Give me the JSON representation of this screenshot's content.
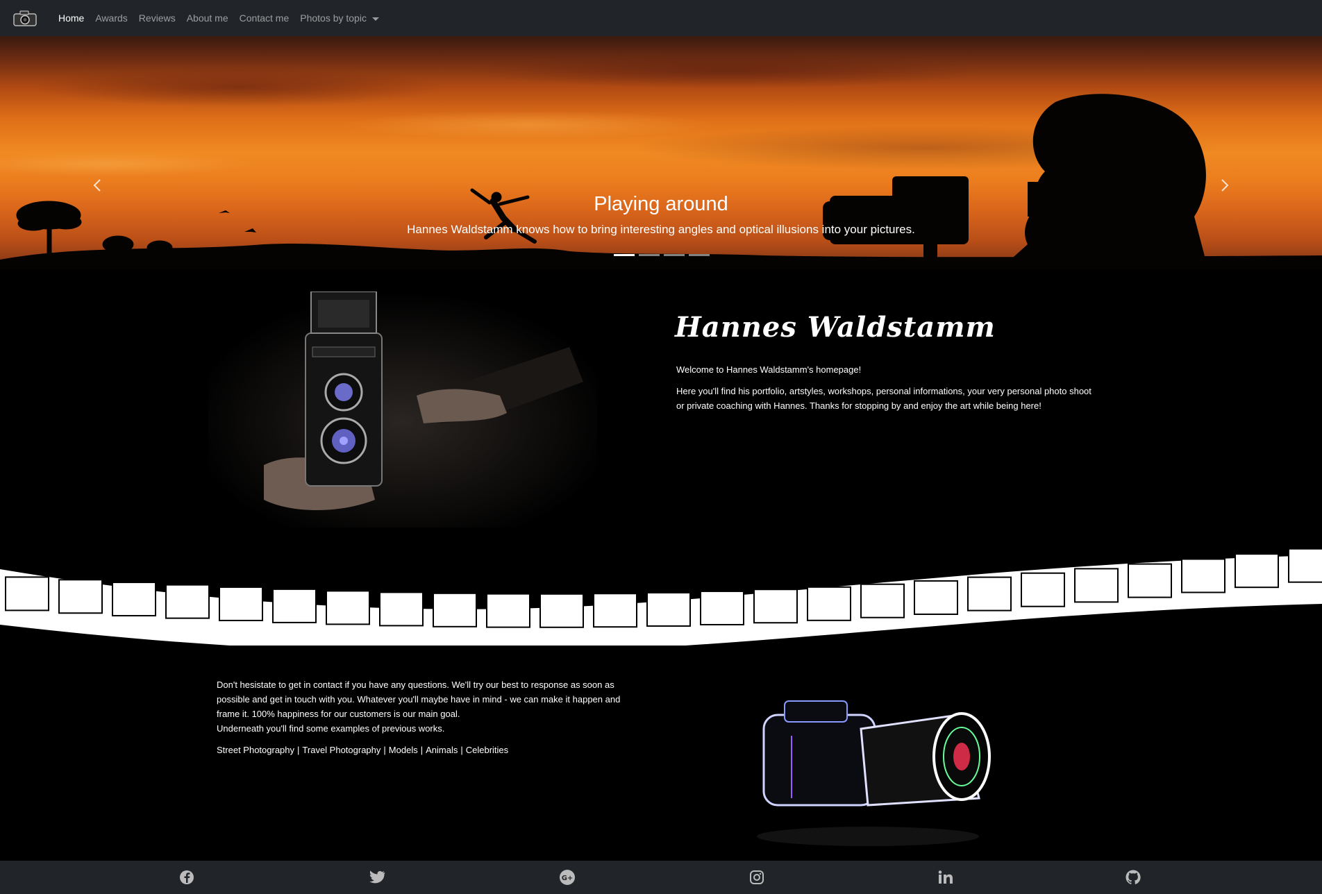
{
  "navbar": {
    "brand_icon": "camera-logo-icon",
    "items": [
      {
        "label": "Home",
        "active": true
      },
      {
        "label": "Awards",
        "active": false
      },
      {
        "label": "Reviews",
        "active": false
      },
      {
        "label": "About me",
        "active": false
      },
      {
        "label": "Contact me",
        "active": false
      },
      {
        "label": "Photos by topic",
        "active": false,
        "dropdown": true
      }
    ]
  },
  "carousel": {
    "slide_title": "Playing around",
    "slide_caption": "Hannes Waldstamm knows how to bring interesting angles and optical illusions into your pictures.",
    "indicator_count": 4,
    "active_indicator": 0,
    "prev_icon": "chevron-left-icon",
    "next_icon": "chevron-right-icon"
  },
  "intro": {
    "name": "Hannes Waldstamm",
    "welcome": "Welcome to Hannes Waldstamm's homepage!",
    "description": "Here you'll find his portfolio, artstyles, workshops, personal informations, your very personal photo shoot or private coaching with Hannes. Thanks for stopping by and enjoy the art while being here!"
  },
  "contact": {
    "text": "Don't hesistate to get in contact if you have any questions. We'll try our best to response as soon as possible and get in touch with you. Whatever you'll maybe have in mind - we can make it happen and frame it. 100% happiness for our customers is our main goal.",
    "examples_line": "Underneath you'll find some examples of previous works.",
    "topics": [
      "Street Photography",
      "Travel Photography",
      "Models",
      "Animals",
      "Celebrities"
    ],
    "separator": "|"
  },
  "footer": {
    "icons": [
      "facebook-icon",
      "twitter-icon",
      "google-plus-icon",
      "instagram-icon",
      "linkedin-icon",
      "github-icon"
    ]
  },
  "colors": {
    "navbar_bg": "#212529",
    "page_bg": "#000000",
    "sky_orange": "#f08a22"
  }
}
